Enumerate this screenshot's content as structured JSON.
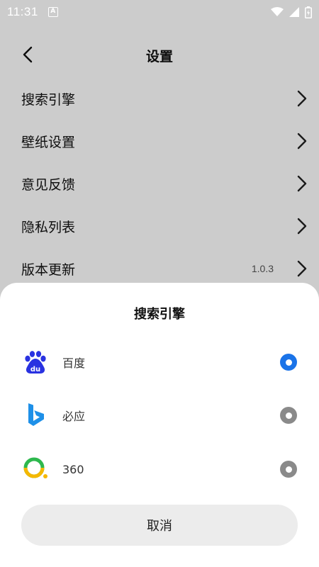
{
  "status_bar": {
    "time": "11:31",
    "notification_icon": "a-letter-icon",
    "icons": [
      "wifi-icon",
      "signal-icon",
      "battery-charging-icon"
    ]
  },
  "header": {
    "title": "设置",
    "back_icon": "chevron-left-icon"
  },
  "settings": {
    "items": [
      {
        "label": "搜索引擎",
        "value": ""
      },
      {
        "label": "壁纸设置",
        "value": ""
      },
      {
        "label": "意见反馈",
        "value": ""
      },
      {
        "label": "隐私列表",
        "value": ""
      },
      {
        "label": "版本更新",
        "value": "1.0.3"
      }
    ]
  },
  "sheet": {
    "title": "搜索引擎",
    "engines": [
      {
        "name": "百度",
        "icon": "baidu-icon",
        "selected": true
      },
      {
        "name": "必应",
        "icon": "bing-icon",
        "selected": false
      },
      {
        "name": "360",
        "icon": "360-icon",
        "selected": false
      }
    ],
    "cancel_label": "取消"
  },
  "colors": {
    "selected_radio": "#1a73e8",
    "unselected_radio": "#8a8a8a",
    "baidu_blue": "#2932e1",
    "bing_blue": "#1e90e8",
    "three60_green": "#2db84d",
    "three60_yellow": "#f5b800"
  }
}
